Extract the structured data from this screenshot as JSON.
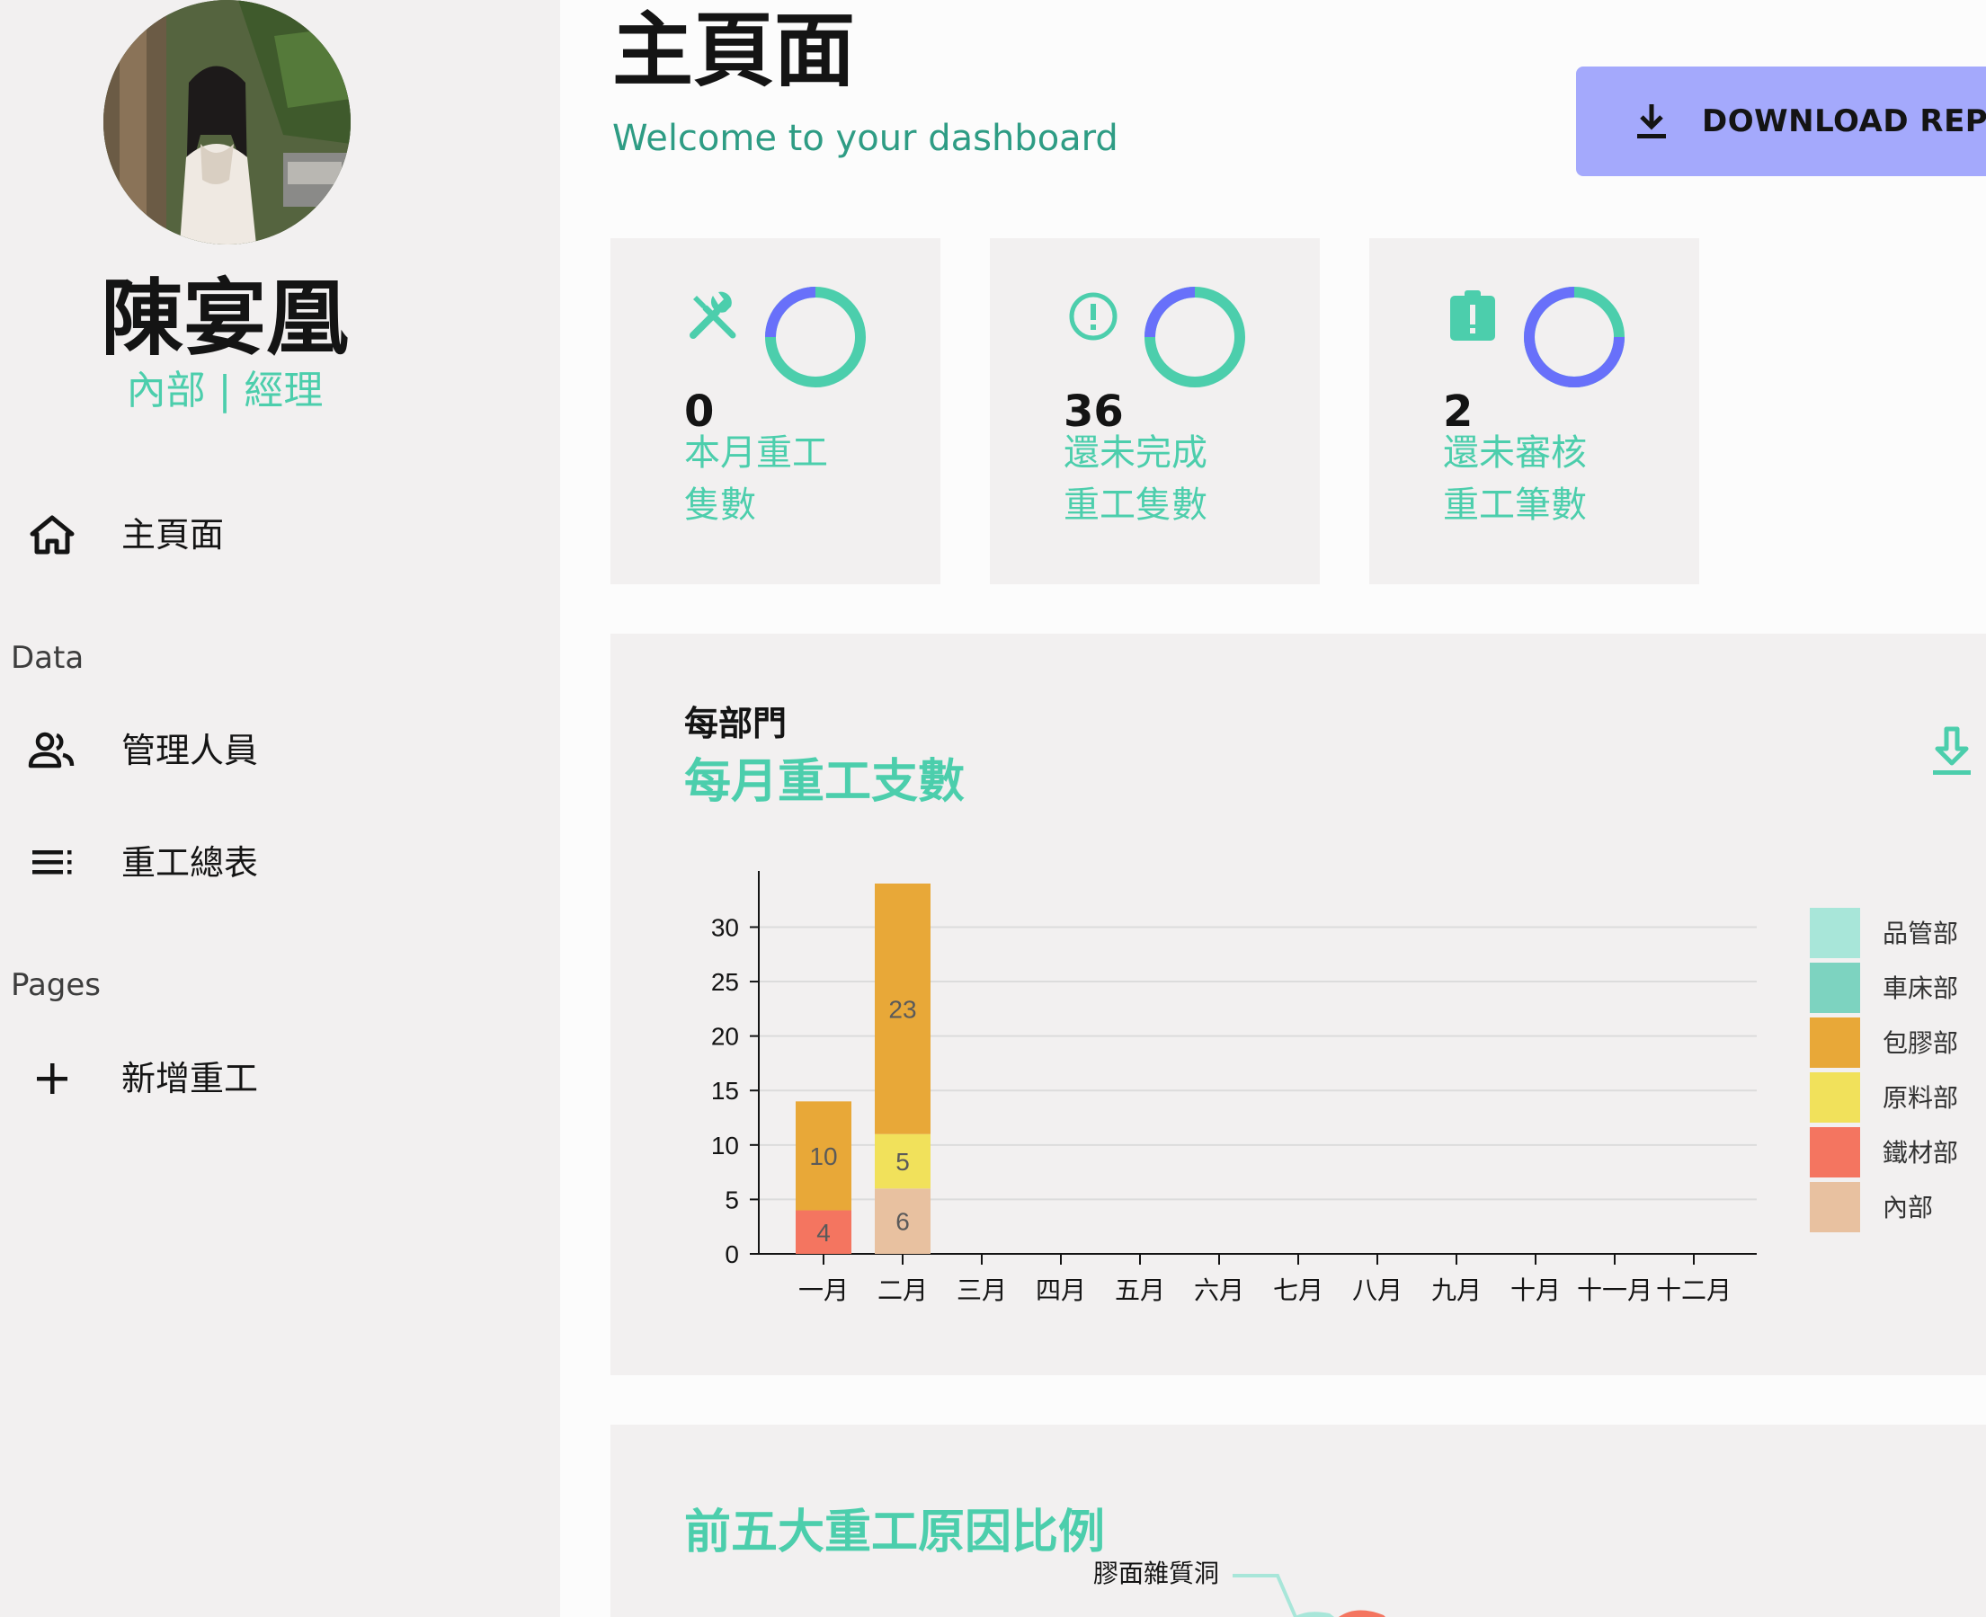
{
  "user": {
    "name": "陳宴凰",
    "role": "內部 | 經理"
  },
  "nav": {
    "home": "主頁面",
    "section_data": "Data",
    "manage_staff": "管理人員",
    "rework_table": "重工總表",
    "section_pages": "Pages",
    "add_rework": "新增重工"
  },
  "header": {
    "title": "主頁面",
    "subtitle": "Welcome to your dashboard",
    "download_label": "DOWNLOAD REPORTS"
  },
  "stats": [
    {
      "value": "0",
      "label": "本月重工隻數",
      "progress": 0.25,
      "icon": "tools-icon"
    },
    {
      "value": "36",
      "label": "還未完成重工隻數",
      "progress": 0.25,
      "icon": "alert-circle-icon"
    },
    {
      "value": "2",
      "label": "還未審核重工筆數",
      "progress": 0.75,
      "icon": "clipboard-alert-icon"
    }
  ],
  "colors": {
    "accent": "#4cceac",
    "ring_fill": "#6870fa",
    "button": "#a4a9fc"
  },
  "bar_panel": {
    "heading": "每部門",
    "subheading": "每月重工支數"
  },
  "pie_panel": {
    "title": "前五大重工原因比例",
    "first_label": "膠面雜質洞"
  },
  "chart_data": {
    "type": "bar",
    "stacked": true,
    "categories": [
      "一月",
      "二月",
      "三月",
      "四月",
      "五月",
      "六月",
      "七月",
      "八月",
      "九月",
      "十月",
      "十一月",
      "十二月"
    ],
    "series": [
      {
        "name": "品管部",
        "color": "#a8e6d9",
        "values": [
          0,
          0,
          0,
          0,
          0,
          0,
          0,
          0,
          0,
          0,
          0,
          0
        ]
      },
      {
        "name": "車床部",
        "color": "#7dd3c0",
        "values": [
          0,
          0,
          0,
          0,
          0,
          0,
          0,
          0,
          0,
          0,
          0,
          0
        ]
      },
      {
        "name": "包膠部",
        "color": "#e8a838",
        "values": [
          10,
          23,
          0,
          0,
          0,
          0,
          0,
          0,
          0,
          0,
          0,
          0
        ]
      },
      {
        "name": "原料部",
        "color": "#f1e15b",
        "values": [
          0,
          5,
          0,
          0,
          0,
          0,
          0,
          0,
          0,
          0,
          0,
          0
        ]
      },
      {
        "name": "鐵材部",
        "color": "#f47560",
        "values": [
          4,
          0,
          0,
          0,
          0,
          0,
          0,
          0,
          0,
          0,
          0,
          0
        ]
      },
      {
        "name": "內部",
        "color": "#e8c1a0",
        "values": [
          0,
          6,
          0,
          0,
          0,
          0,
          0,
          0,
          0,
          0,
          0,
          0
        ]
      }
    ],
    "yticks": [
      0,
      5,
      10,
      15,
      20,
      25,
      30
    ],
    "ylim": [
      0,
      34
    ],
    "grid": true,
    "legend": "right"
  }
}
